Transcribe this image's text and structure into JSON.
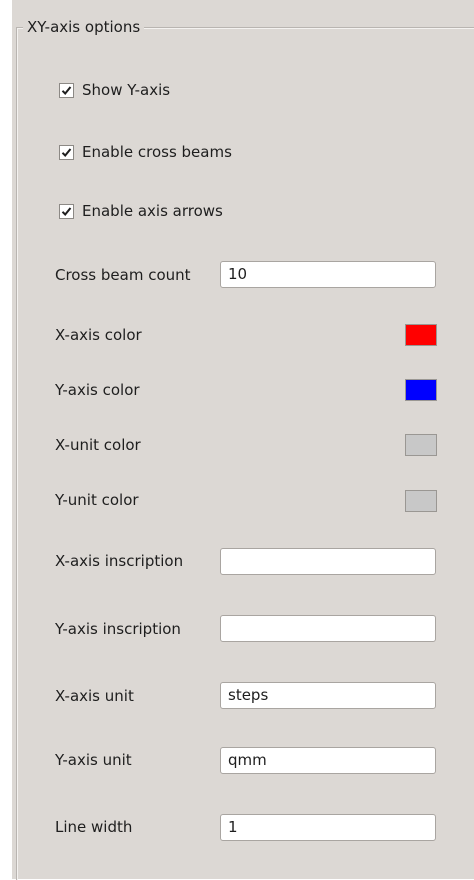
{
  "group": {
    "title": "XY-axis options"
  },
  "checkboxes": [
    {
      "label": "Show Y-axis",
      "checked": true
    },
    {
      "label": "Enable cross beams",
      "checked": true
    },
    {
      "label": "Enable axis arrows",
      "checked": true
    }
  ],
  "cross_beam_count": {
    "label": "Cross beam count",
    "value": "10"
  },
  "colors": [
    {
      "label": "X-axis color",
      "color": "#ff0000"
    },
    {
      "label": "Y-axis color",
      "color": "#0000ff"
    },
    {
      "label": "X-unit color",
      "color": "#c8c8c8"
    },
    {
      "label": "Y-unit color",
      "color": "#c8c8c8"
    }
  ],
  "fields": [
    {
      "label": "X-axis inscription",
      "value": ""
    },
    {
      "label": "Y-axis inscription",
      "value": ""
    },
    {
      "label": "X-axis unit",
      "value": "steps"
    },
    {
      "label": "Y-axis unit",
      "value": "qmm"
    },
    {
      "label": "Line width",
      "value": "1"
    }
  ]
}
